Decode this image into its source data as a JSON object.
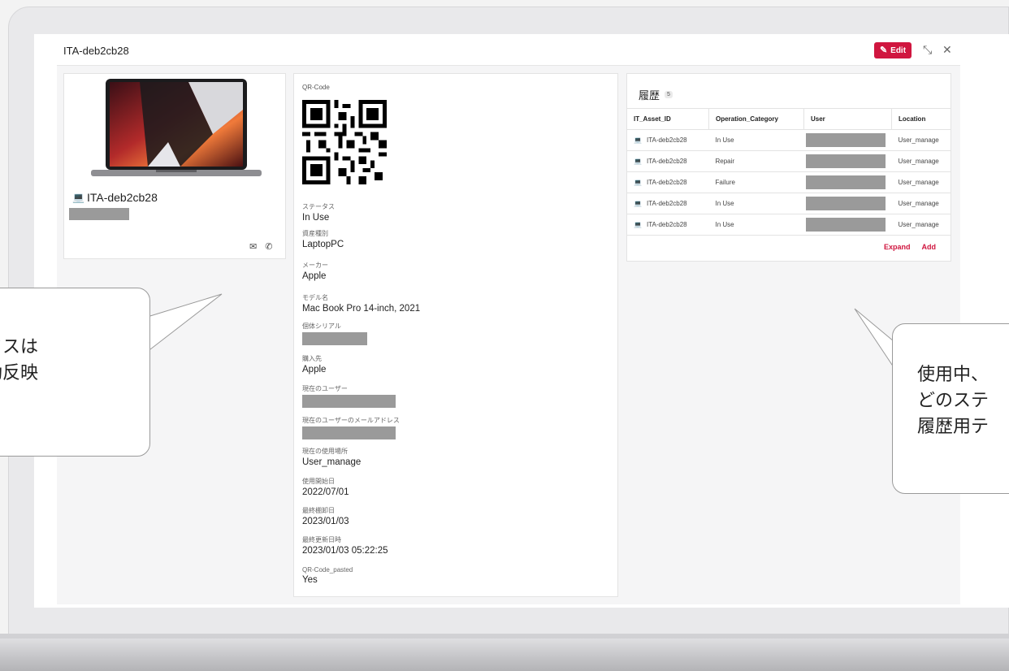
{
  "app": {
    "title": "ITA-deb2cb28",
    "edit_label": "Edit",
    "icons": {
      "edit": "edit-icon",
      "expand": "expand-arrows-icon",
      "close": "close-icon"
    }
  },
  "asset_card": {
    "name": "ITA-deb2cb28",
    "icons": [
      "laptop-icon",
      "mail-icon",
      "phone-icon"
    ]
  },
  "details": {
    "qr_label": "QR-Code",
    "fields": [
      {
        "label": "ステータス",
        "value": "In Use"
      },
      {
        "label": "資産種別",
        "value": "LaptopPC"
      },
      {
        "label": "メーカー",
        "value": "Apple"
      },
      {
        "label": "モデル名",
        "value": "Mac Book Pro 14-inch, 2021"
      },
      {
        "label": "個体シリアル",
        "value": ""
      },
      {
        "label": "購入先",
        "value": "Apple"
      },
      {
        "label": "現在のユーザー",
        "value": ""
      },
      {
        "label": "現在のユーザーのメールアドレス",
        "value": ""
      },
      {
        "label": "現在の使用場所",
        "value": "User_manage"
      },
      {
        "label": "使用開始日",
        "value": "2022/07/01"
      },
      {
        "label": "最終棚卸日",
        "value": "2023/01/03"
      },
      {
        "label": "最終更新日時",
        "value": "2023/01/03 05:22:25"
      },
      {
        "label": "QR-Code_pasted",
        "value": "Yes"
      }
    ]
  },
  "history": {
    "title": "履歴",
    "count": "5",
    "columns": [
      "IT_Asset_ID",
      "Operation_Category",
      "User",
      "Location"
    ],
    "rows": [
      {
        "asset": "ITA-deb2cb28",
        "op": "In Use",
        "user": "",
        "location": "User_manage"
      },
      {
        "asset": "ITA-deb2cb28",
        "op": "Repair",
        "user": "",
        "location": "User_manage"
      },
      {
        "asset": "ITA-deb2cb28",
        "op": "Failure",
        "user": "",
        "location": "User_manage"
      },
      {
        "asset": "ITA-deb2cb28",
        "op": "In Use",
        "user": "",
        "location": "User_manage"
      },
      {
        "asset": "ITA-deb2cb28",
        "op": "In Use",
        "user": "",
        "location": "User_manage"
      }
    ],
    "expand_label": "Expand",
    "add_label": "Add"
  },
  "callouts": {
    "left_lines": [
      "タスは",
      "動反映"
    ],
    "right_lines": [
      "使用中、",
      "どのステ",
      "履歴用テ"
    ]
  },
  "colors": {
    "accent": "#d0163f",
    "redaction": "#9a9a9a"
  }
}
